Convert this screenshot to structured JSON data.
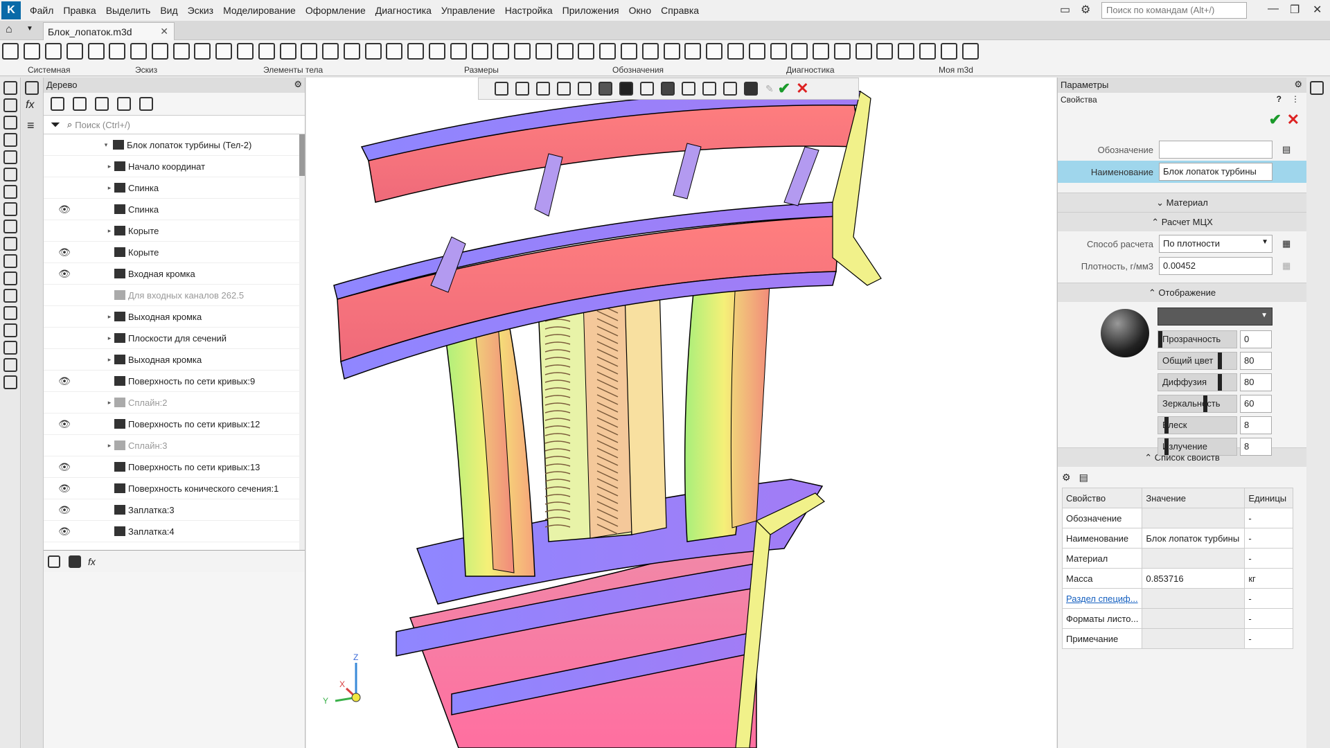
{
  "menu": {
    "app_logo": "K",
    "items": [
      "Файл",
      "Правка",
      "Выделить",
      "Вид",
      "Эскиз",
      "Моделирование",
      "Оформление",
      "Диагностика",
      "Управление",
      "Настройка",
      "Приложения",
      "Окно",
      "Справка"
    ],
    "search_placeholder": "Поиск по командам (Alt+/)"
  },
  "doc_tab": {
    "title": "Блок_лопаток.m3d",
    "close": "✕"
  },
  "toolbar_groups": [
    "Системная",
    "Эскиз",
    "Элементы тела",
    "Размеры",
    "Обозначения",
    "Диагностика",
    "Моя m3d"
  ],
  "tree_panel": {
    "title": "Дерево",
    "search_placeholder": "Поиск (Ctrl+/)",
    "root": "Блок лопаток турбины (Тел-2)",
    "rows": [
      {
        "label": "Начало координат",
        "eye": false,
        "arrow": "▸",
        "dim": false
      },
      {
        "label": "Спинка",
        "eye": false,
        "arrow": "▸",
        "dim": false
      },
      {
        "label": "Спинка",
        "eye": true,
        "arrow": "",
        "dim": false
      },
      {
        "label": "Корыте",
        "eye": false,
        "arrow": "▸",
        "dim": false
      },
      {
        "label": "Корыте",
        "eye": true,
        "arrow": "",
        "dim": false
      },
      {
        "label": "Входная кромка",
        "eye": true,
        "arrow": "",
        "dim": false
      },
      {
        "label": "Для входных каналов 262.5",
        "eye": false,
        "arrow": "",
        "dim": true
      },
      {
        "label": "Выходная кромка",
        "eye": false,
        "arrow": "▸",
        "dim": false
      },
      {
        "label": "Плоскости для сечений",
        "eye": false,
        "arrow": "▸",
        "dim": false
      },
      {
        "label": "Выходная кромка",
        "eye": false,
        "arrow": "▸",
        "dim": false
      },
      {
        "label": "Поверхность по сети кривых:9",
        "eye": true,
        "arrow": "",
        "dim": false
      },
      {
        "label": "Сплайн:2",
        "eye": false,
        "arrow": "▸",
        "dim": true
      },
      {
        "label": "Поверхность по сети кривых:12",
        "eye": true,
        "arrow": "",
        "dim": false
      },
      {
        "label": "Сплайн:3",
        "eye": false,
        "arrow": "▸",
        "dim": true
      },
      {
        "label": "Поверхность по сети кривых:13",
        "eye": true,
        "arrow": "",
        "dim": false
      },
      {
        "label": "Поверхность конического сечения:1",
        "eye": true,
        "arrow": "",
        "dim": false
      },
      {
        "label": "Заплатка:3",
        "eye": true,
        "arrow": "",
        "dim": false
      },
      {
        "label": "Заплатка:4",
        "eye": true,
        "arrow": "",
        "dim": false
      }
    ],
    "bottom_fx": "fx"
  },
  "viewport": {
    "axes": {
      "x": "X",
      "y": "Y",
      "z": "Z"
    }
  },
  "params_panel": {
    "title": "Параметры",
    "subtitle": "Свойства",
    "designation_label": "Обозначение",
    "designation_value": "",
    "name_label": "Наименование",
    "name_value": "Блок лопаток турбины",
    "sections": {
      "material": "Материал",
      "mass_calc": "Расчет МЦХ",
      "display": "Отображение",
      "prop_list": "Список свойств"
    },
    "calc_method_label": "Способ расчета",
    "calc_method_value": "По плотности",
    "density_label": "Плотность, г/мм3",
    "density_value": "0.00452",
    "display_props": [
      {
        "label": "Прозрачность",
        "value": "0",
        "level": 0
      },
      {
        "label": "Общий цвет",
        "value": "80",
        "level": 0.8
      },
      {
        "label": "Диффузия",
        "value": "80",
        "level": 0.8
      },
      {
        "label": "Зеркальность",
        "value": "60",
        "level": 0.6
      },
      {
        "label": "Блеск",
        "value": "8",
        "level": 0.08
      },
      {
        "label": "Излучение",
        "value": "8",
        "level": 0.08
      }
    ],
    "table": {
      "headers": [
        "Свойство",
        "Значение",
        "Единицы"
      ],
      "rows": [
        [
          "Обозначение",
          "",
          "-"
        ],
        [
          "Наименование",
          "Блок лопаток турбины",
          "-"
        ],
        [
          "Материал",
          "",
          "-"
        ],
        [
          "Масса",
          "0.853716",
          "кг"
        ],
        [
          "Раздел специф...",
          "",
          "-"
        ],
        [
          "Форматы листо...",
          "",
          "-"
        ],
        [
          "Примечание",
          "",
          "-"
        ]
      ]
    }
  },
  "colors": {
    "accent": "#0a6aa8",
    "highlight": "#9fd6ec",
    "check": "#1a9a2a",
    "cross": "#d22222"
  }
}
